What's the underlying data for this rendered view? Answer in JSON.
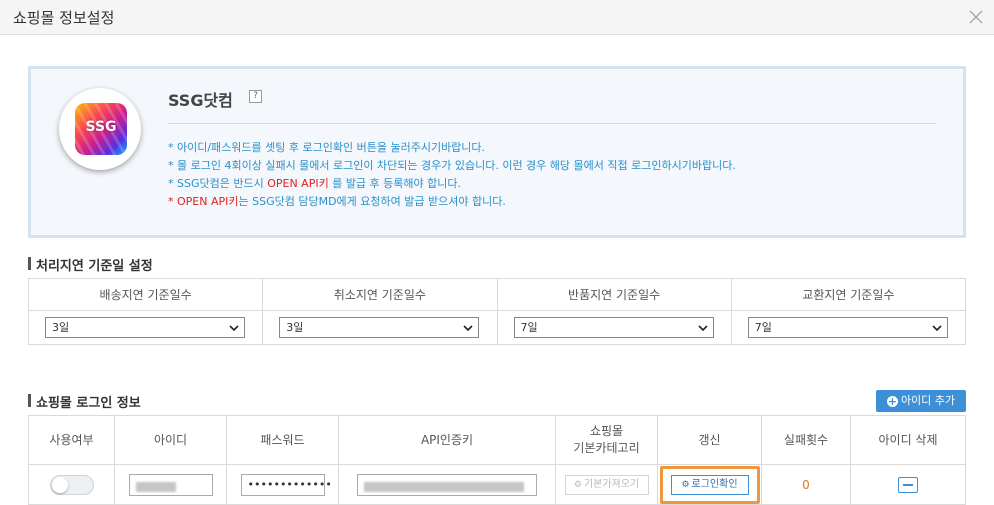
{
  "window": {
    "title": "쇼핑몰 정보설정"
  },
  "info": {
    "logo_text": "SSG",
    "mall_name": "SSG닷컴",
    "help_label": "?",
    "notes": {
      "n1": "* 아이디/패스워드를 셋팅 후 로그인확인 버튼을 눌러주시기바랍니다.",
      "n2": "* 몰 로그인 4회이상 실패시 몰에서 로그인이 차단되는 경우가 있습니다. 이런 경우 해당 몰에서 직접 로그인하시기바랍니다.",
      "n3a": "* SSG닷컴은 반드시 ",
      "n3b": "OPEN API키",
      "n3c": " 를 발급 후 등록해야 합니다.",
      "n4a": "* ",
      "n4b": "OPEN API키",
      "n4c": "는 SSG닷컴 담당MD에게 요청하여 발급 받으셔야 합니다."
    },
    "colors": {
      "note_blue": "#2a8fc9",
      "note_red": "#e02020"
    }
  },
  "delay": {
    "title": "처리지연 기준일 설정",
    "headers": [
      "배송지연 기준일수",
      "취소지연 기준일수",
      "반품지연 기준일수",
      "교환지연 기준일수"
    ],
    "values": [
      "3일",
      "3일",
      "7일",
      "7일"
    ]
  },
  "login": {
    "title": "쇼핑몰 로그인 정보",
    "add_button": "아이디 추가",
    "headers": {
      "use": "사용여부",
      "id": "아이디",
      "password": "패스워드",
      "api_key": "API인증키",
      "category_line1": "쇼핑몰",
      "category_line2": "기본카테고리",
      "refresh": "갱신",
      "fail_count": "실패횟수",
      "delete": "아이디 삭제"
    },
    "row": {
      "use_enabled": false,
      "password_mask": "•••••••••••••",
      "fetch_button": "기본가져오기",
      "login_check_button": "로그인확인",
      "fail_count": "0"
    },
    "highlight_color": "#f0963c",
    "accent_color": "#3d8fd8"
  }
}
